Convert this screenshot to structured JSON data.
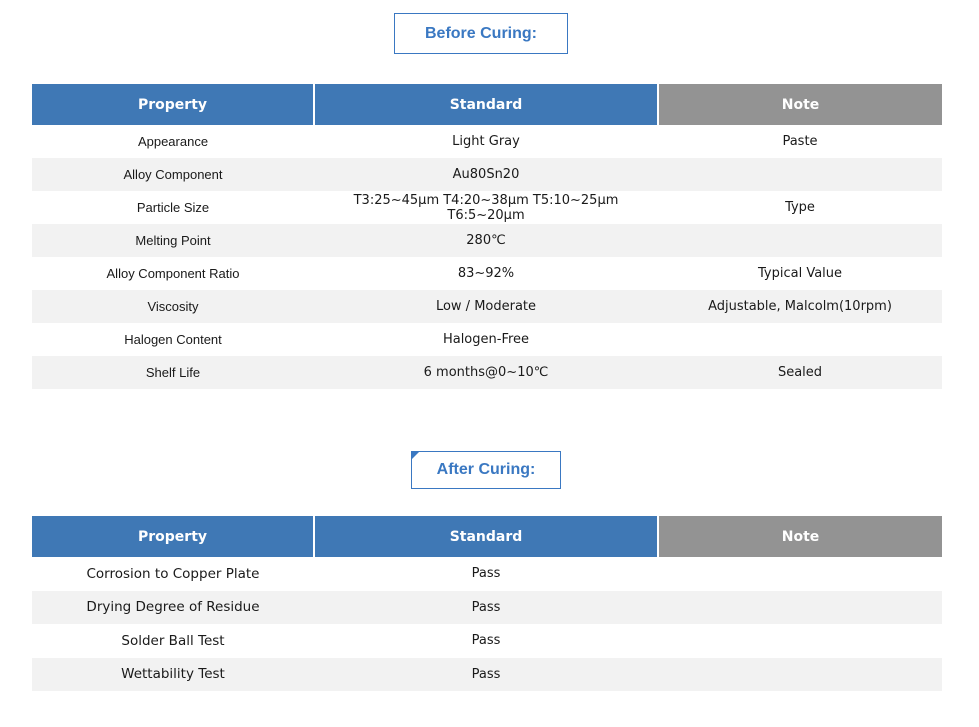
{
  "before": {
    "title": "Before Curing:",
    "headers": {
      "property": "Property",
      "standard": "Standard",
      "note": "Note"
    },
    "rows": [
      {
        "property": "Appearance",
        "standard": "Light Gray",
        "note": "Paste"
      },
      {
        "property": "Alloy Component",
        "standard": "Au80Sn20",
        "note": ""
      },
      {
        "property": "Particle Size",
        "standard": "T3:25~45μm T4:20~38μm T5:10~25μm T6:5~20μm",
        "note": "Type"
      },
      {
        "property": "Melting Point",
        "standard": "280℃",
        "note": ""
      },
      {
        "property": "Alloy Component Ratio",
        "standard": "83~92%",
        "note": "Typical Value"
      },
      {
        "property": "Viscosity",
        "standard": "Low / Moderate",
        "note": "Adjustable, Malcolm(10rpm)"
      },
      {
        "property": "Halogen Content",
        "standard": "Halogen-Free",
        "note": ""
      },
      {
        "property": "Shelf Life",
        "standard": "6 months@0~10℃",
        "note": "Sealed"
      }
    ]
  },
  "after": {
    "title": "After Curing:",
    "headers": {
      "property": "Property",
      "standard": "Standard",
      "note": "Note"
    },
    "rows": [
      {
        "property": "Corrosion to Copper Plate",
        "standard": "Pass",
        "note": ""
      },
      {
        "property": "Drying Degree of Residue",
        "standard": "Pass",
        "note": ""
      },
      {
        "property": "Solder Ball Test",
        "standard": "Pass",
        "note": ""
      },
      {
        "property": "Wettability Test",
        "standard": "Pass",
        "note": ""
      }
    ]
  },
  "colors": {
    "header_blue": "#3f78b5",
    "header_gray": "#939393",
    "title_blue": "#3a78c2",
    "stripe": "#f2f2f2"
  }
}
